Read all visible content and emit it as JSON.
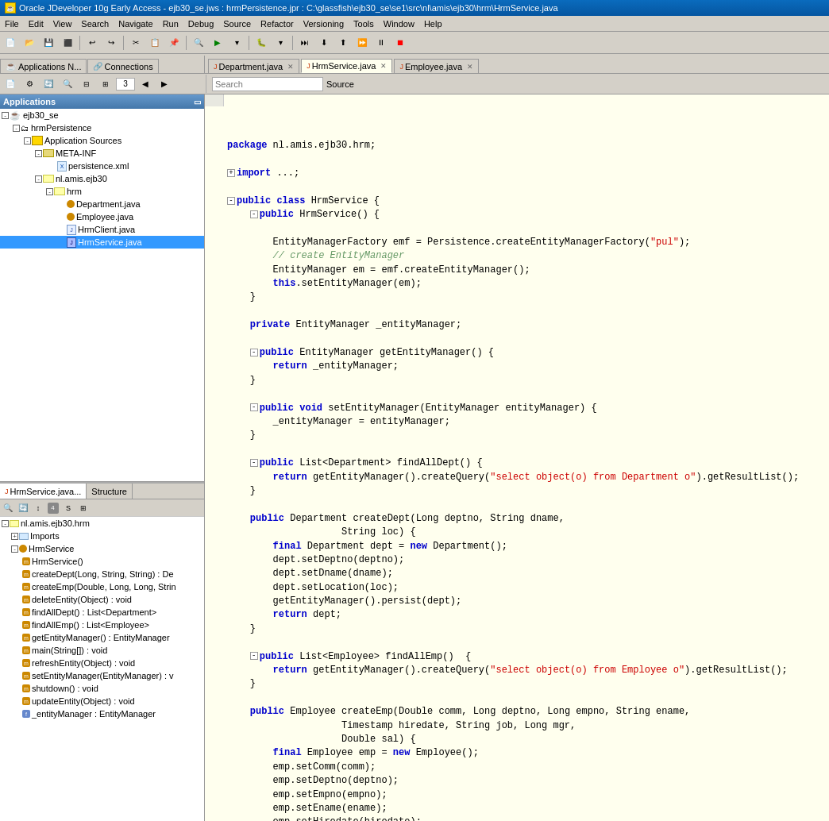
{
  "window": {
    "title": "Oracle JDeveloper 10g Early Access - ejb30_se.jws : hrmPersistence.jpr : C:\\glassfish\\ejb30_se\\se1\\src\\nl\\amis\\ejb30\\hrm\\HrmService.java"
  },
  "menubar": {
    "items": [
      "File",
      "Edit",
      "View",
      "Search",
      "Navigate",
      "Run",
      "Debug",
      "Source",
      "Refactor",
      "Versioning",
      "Tools",
      "Window",
      "Help"
    ]
  },
  "tabs": {
    "top_panel_tabs": [
      "Applications N...",
      "Connections"
    ],
    "editor_tabs": [
      "Department.java",
      "HrmService.java",
      "Employee.java"
    ]
  },
  "applications_panel": {
    "title": "Applications",
    "tree": {
      "root": "ejb30_se",
      "project": "hrmPersistence",
      "application_sources": "Application Sources",
      "meta_inf": "META-INF",
      "persistence_xml": "persistence.xml",
      "package": "nl.amis.ejb30",
      "hrm_pkg": "hrm",
      "files": [
        "Department.java",
        "Employee.java",
        "HrmClient.java",
        "HrmService.java"
      ]
    }
  },
  "bottom_panel": {
    "tabs": [
      "HrmService.java...",
      "Structure"
    ],
    "tree_title": "nl.amis.ejb30.hrm",
    "imports": "Imports",
    "hrm_service": "HrmService",
    "methods": [
      "HrmService()",
      "createDept(Long, String, String) : De",
      "createEmp(Double, Long, Long, Strin",
      "deleteEntity(Object) : void",
      "findAllDept() : List<Department>",
      "findAllEmp() : List<Employee>",
      "getEntityManager() : EntityManager",
      "main(String[]) : void",
      "refreshEntity(Object) : void",
      "setEntityManager(EntityManager) : v",
      "shutdown() : void",
      "updateEntity(Object) : void",
      "_entityManager : EntityManager"
    ]
  },
  "code": {
    "package_decl": "package nl.amis.ejb30.hrm;",
    "import_decl": "import ...;",
    "class_decl": "public class HrmService {",
    "content": "full java code"
  },
  "colors": {
    "title_bar_bg": "#0a6bbd",
    "keyword": "#0000cc",
    "string": "#cc0000",
    "comment": "#669966",
    "background_code": "#ffffee",
    "panel_header": "#4477aa"
  },
  "second_toolbar": {
    "search_placeholder": "Search",
    "source_label": "Source"
  }
}
